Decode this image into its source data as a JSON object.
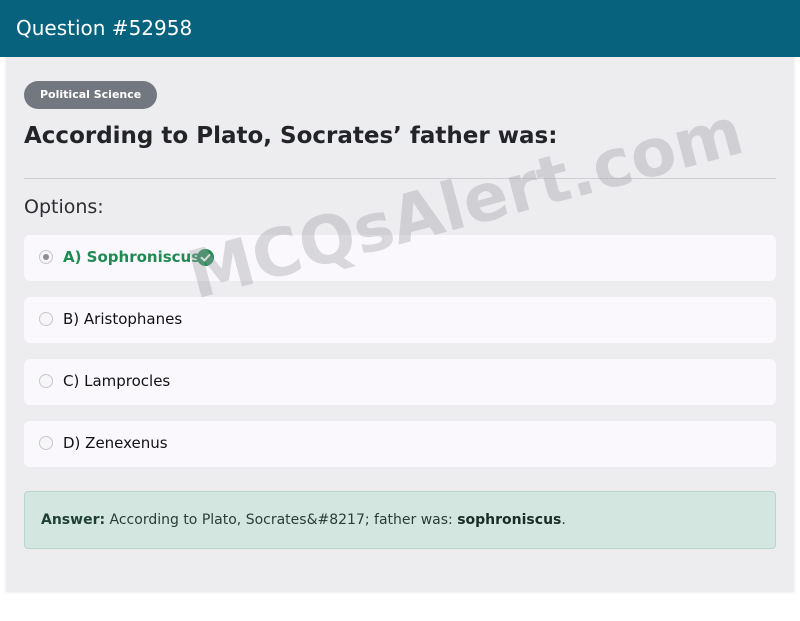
{
  "header": {
    "title": "Question #52958"
  },
  "category": "Political Science",
  "question": "According to Plato, Socrates’ father was:",
  "options_heading": "Options:",
  "options": [
    {
      "label": "A) Sophroniscus",
      "selected": true,
      "correct": true
    },
    {
      "label": "B) Aristophanes",
      "selected": false,
      "correct": false
    },
    {
      "label": "C) Lamprocles",
      "selected": false,
      "correct": false
    },
    {
      "label": "D) Zenexenus",
      "selected": false,
      "correct": false
    }
  ],
  "answer": {
    "label": "Answer:",
    "text": "According to Plato, Socrates&#8217; father was:",
    "value": "sophroniscus",
    "end": "."
  },
  "watermark": "MCQsAlert.com",
  "icons": {
    "correct": "check-circle-icon"
  },
  "colors": {
    "header_bg": "#07627d",
    "correct_green": "#1f8a52",
    "answer_bg": "#d3e7e0",
    "tag_bg": "#737880"
  }
}
